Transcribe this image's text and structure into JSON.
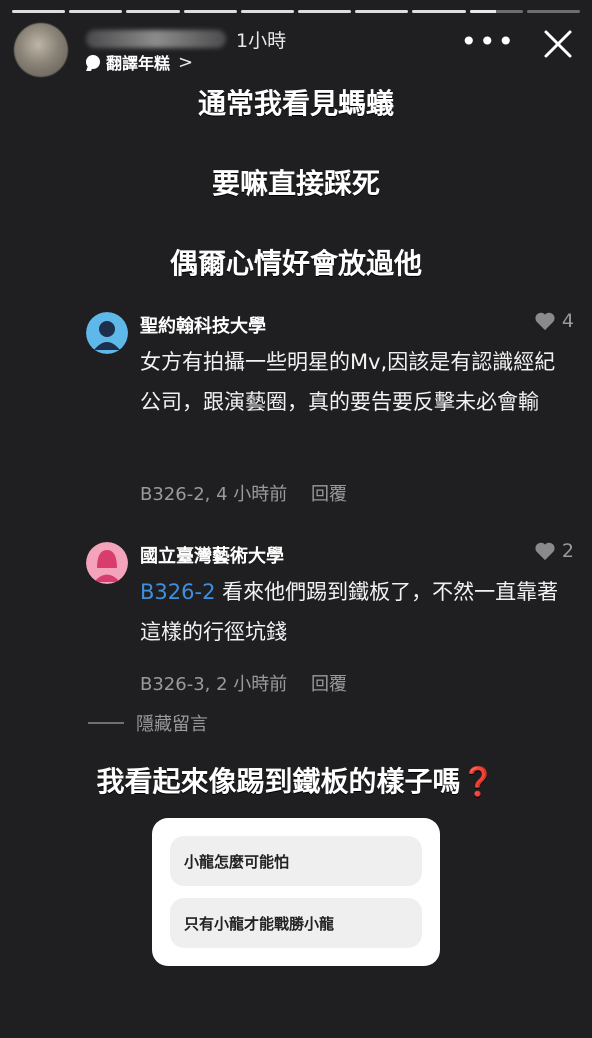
{
  "story": {
    "progress": {
      "total_segments": 10,
      "completed": 8,
      "current_fraction": 0.5
    },
    "header": {
      "time_ago": "1小時",
      "translate_label": "翻譯年糕",
      "translate_chevron": ">",
      "more_icon": "more-dots-icon",
      "close_icon": "close-x-icon"
    },
    "text_lines": [
      "通常我看見螞蟻",
      "要嘛直接踩死",
      "偶爾心情好會放過他"
    ]
  },
  "comments": [
    {
      "school": "聖約翰科技大學",
      "avatar_color": "#5fb8ea",
      "likes": "4",
      "mention": "",
      "body": "女方有拍攝一些明星的Mv,因該是有認識經紀公司，跟演藝圈，真的要告要反擊未必會輸",
      "meta": "B326-2, 4 小時前",
      "reply_label": "回覆"
    },
    {
      "school": "國立臺灣藝術大學",
      "avatar_color": "#f4a3bd",
      "likes": "2",
      "mention": "B326-2",
      "body": "看來他們踢到鐵板了，不然一直靠著這樣的行徑坑錢",
      "meta": "B326-3, 2 小時前",
      "reply_label": "回覆"
    }
  ],
  "hidden_comments_label": "隱藏留言",
  "question": {
    "text": "我看起來像踢到鐵板的樣子嗎",
    "mark": "❓"
  },
  "poll": {
    "options": [
      "小龍怎麼可能怕",
      "只有小龍才能戰勝小龍"
    ]
  }
}
